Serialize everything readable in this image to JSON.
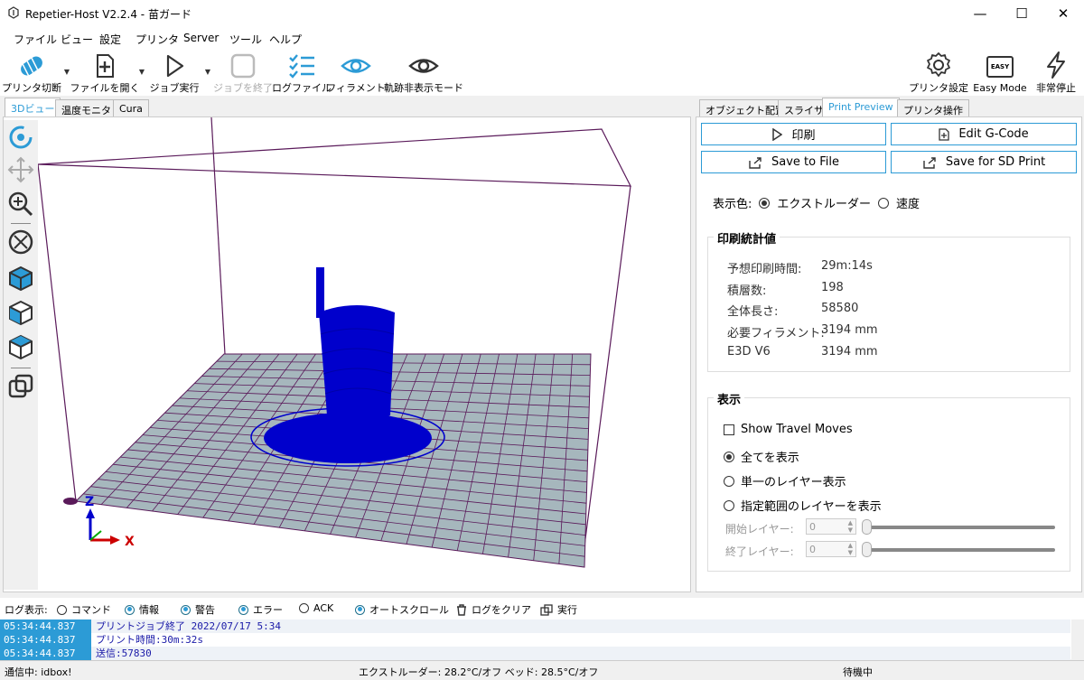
{
  "window": {
    "title": "Repetier-Host V2.2.4 - 苗ガード"
  },
  "menu": [
    "ファイル",
    "ビュー",
    "設定",
    "プリンタ",
    "Server",
    "ツール",
    "ヘルプ"
  ],
  "toolbar": {
    "slice": "プリンタ切断",
    "open": "ファイルを開く",
    "run": "ジョブ実行",
    "stop": "ジョブを終了",
    "log": "ログファイル",
    "filament": "フィラメント",
    "hide_path": "軌跡非表示モード",
    "printer_settings": "プリンタ設定",
    "easy_mode": "Easy Mode",
    "easy_badge": "EASY",
    "emergency": "非常停止"
  },
  "left_tabs": [
    "3Dビュー",
    "温度モニタ",
    "Cura"
  ],
  "right_tabs": [
    "オブジェクト配置",
    "スライサ",
    "Print Preview",
    "プリンタ操作"
  ],
  "viewport": {
    "axis_z": "Z",
    "axis_x": "X"
  },
  "preview": {
    "print_button": "印刷",
    "edit_gcode_button": "Edit G-Code",
    "save_file_button": "Save to File",
    "save_sd_button": "Save for SD Print",
    "color_label": "表示色:",
    "color_options": [
      "エクストルーダー",
      "速度"
    ],
    "stats_title": "印刷統計値",
    "stats": [
      {
        "label": "予想印刷時間:",
        "value": "29m:14s"
      },
      {
        "label": "積層数:",
        "value": "198"
      },
      {
        "label": "全体長さ:",
        "value": "58580"
      },
      {
        "label": "必要フィラメント:",
        "value": "3194 mm"
      },
      {
        "label": "E3D V6",
        "value": "3194 mm"
      }
    ],
    "display_title": "表示",
    "show_travel": "Show Travel Moves",
    "show_all": "全てを表示",
    "single_layer": "単一のレイヤー表示",
    "range_layer": "指定範囲のレイヤーを表示",
    "start_layer_label": "開始レイヤー:",
    "start_layer_value": "0",
    "end_layer_label": "終了レイヤー:",
    "end_layer_value": "0"
  },
  "log_options": {
    "label": "ログ表示:",
    "command": "コマンド",
    "info": "情報",
    "warning": "警告",
    "error": "エラー",
    "ack": "ACK",
    "autoscroll": "オートスクロール",
    "clear": "ログをクリア",
    "execute": "実行"
  },
  "logs": [
    {
      "time": "05:34:44.837",
      "msg": "プリントジョブ終了 2022/07/17 5:34"
    },
    {
      "time": "05:34:44.837",
      "msg": "プリント時間:30m:32s"
    },
    {
      "time": "05:34:44.837",
      "msg": "送信:57830"
    }
  ],
  "status": {
    "connection": "通信中: idbox!",
    "temps": "エクストルーダー: 28.2°C/オフ ベッド: 28.5°C/オフ",
    "state": "待機中"
  },
  "colors": {
    "accent": "#2c9bd6",
    "model": "#0000cc",
    "bed": "#a6b7bd",
    "frame": "#5a1a5a"
  }
}
